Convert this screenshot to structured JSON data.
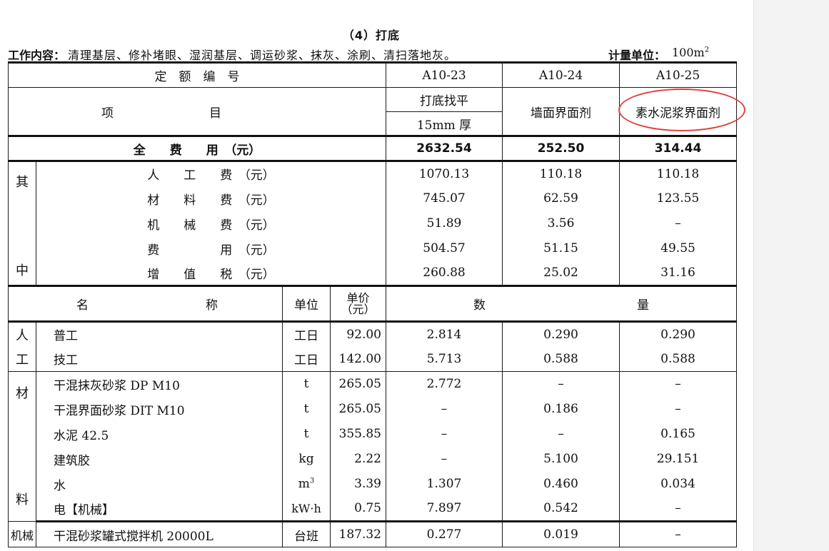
{
  "title": "（4）打底",
  "work_content": {
    "label": "工作内容：",
    "text": "清理基层、修补堵眼、湿润基层、调运砂浆、抹灰、涂刷、清扫落地灰。"
  },
  "unit": {
    "label": "计量单位：",
    "value": "100m",
    "exponent": "2"
  },
  "header": {
    "quota_no_label": "定　额　编　号",
    "item_left": "项",
    "item_right": "目",
    "codes": [
      "A10-23",
      "A10-24",
      "A10-25"
    ],
    "col1_name_top": "打底找平",
    "col1_name_bottom": "15mm 厚",
    "col2_name": "墙面界面剂",
    "col3_name": "素水泥浆界面剂"
  },
  "total": {
    "label": "全　　费　　用　（元）",
    "values": [
      "2632.54",
      "252.50",
      "314.44"
    ]
  },
  "breakdown": {
    "side_top": "其",
    "side_bottom": "中",
    "rows": [
      {
        "name": "人　　工　　费　（元）",
        "values": [
          "1070.13",
          "110.18",
          "110.18"
        ]
      },
      {
        "name": "材　　料　　费　（元）",
        "values": [
          "745.07",
          "62.59",
          "123.55"
        ]
      },
      {
        "name": "机　　械　　费　（元）",
        "values": [
          "51.89",
          "3.56",
          "–"
        ]
      },
      {
        "name": "费　　　　　用　（元）",
        "values": [
          "504.57",
          "51.15",
          "49.55"
        ]
      },
      {
        "name": "增　　值　　税　（元）",
        "values": [
          "260.88",
          "25.02",
          "31.16"
        ]
      }
    ]
  },
  "resource_header": {
    "name_left": "名",
    "name_right": "称",
    "unit": "单位",
    "price_top": "单价",
    "price_bottom": "（元）",
    "qty_left": "数",
    "qty_right": "量"
  },
  "labor": {
    "side_top": "人",
    "side_bottom": "工",
    "rows": [
      {
        "name": "普工",
        "unit": "工日",
        "price": "92.00",
        "values": [
          "2.814",
          "0.290",
          "0.290"
        ]
      },
      {
        "name": "技工",
        "unit": "工日",
        "price": "142.00",
        "values": [
          "5.713",
          "0.588",
          "0.588"
        ]
      }
    ]
  },
  "materials": {
    "side_top": "材",
    "side_bottom": "料",
    "rows": [
      {
        "name": "干混抹灰砂浆 DP M10",
        "unit": "t",
        "price": "265.05",
        "values": [
          "2.772",
          "–",
          "–"
        ]
      },
      {
        "name": "干混界面砂浆 DIT M10",
        "unit": "t",
        "price": "265.05",
        "values": [
          "–",
          "0.186",
          "–"
        ]
      },
      {
        "name": "水泥 42.5",
        "unit": "t",
        "price": "355.85",
        "values": [
          "–",
          "–",
          "0.165"
        ]
      },
      {
        "name": "建筑胶",
        "unit": "kg",
        "price": "2.22",
        "values": [
          "–",
          "5.100",
          "29.151"
        ]
      },
      {
        "name": "水",
        "unit": "m",
        "unit_exp": "3",
        "price": "3.39",
        "values": [
          "1.307",
          "0.460",
          "0.034"
        ]
      },
      {
        "name": "电【机械】",
        "unit": "kW·h",
        "price": "0.75",
        "values": [
          "7.897",
          "0.542",
          "–"
        ]
      }
    ]
  },
  "machinery": {
    "side": "机械",
    "rows": [
      {
        "name": "干混砂浆罐式搅拌机 20000L",
        "unit": "台班",
        "price": "187.32",
        "values": [
          "0.277",
          "0.019",
          "–"
        ]
      }
    ]
  },
  "annotation": {
    "color": "#e0403a",
    "target": "素水泥浆界面剂"
  }
}
